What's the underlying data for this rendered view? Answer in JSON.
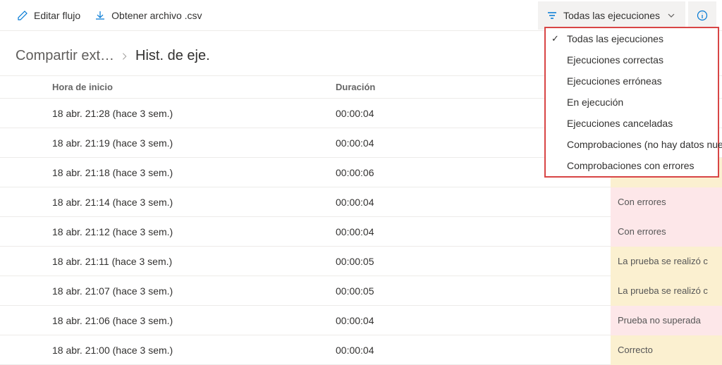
{
  "toolbar": {
    "edit_label": "Editar flujo",
    "download_label": "Obtener archivo .csv",
    "filter_label": "Todas las ejecuciones"
  },
  "breadcrumb": {
    "first": "Compartir ext…",
    "current": "Hist. de eje."
  },
  "table_headers": {
    "start": "Hora de inicio",
    "duration": "Duración"
  },
  "rows": [
    {
      "start": "18 abr. 21:28 (hace 3 sem.)",
      "duration": "00:00:04",
      "status": "",
      "cls": ""
    },
    {
      "start": "18 abr. 21:19 (hace 3 sem.)",
      "duration": "00:00:04",
      "status": "",
      "cls": ""
    },
    {
      "start": "18 abr. 21:18 (hace 3 sem.)",
      "duration": "00:00:06",
      "status": "La prueba se realizó c",
      "cls": "status-warn"
    },
    {
      "start": "18 abr. 21:14 (hace 3 sem.)",
      "duration": "00:00:04",
      "status": "Con errores",
      "cls": "status-error"
    },
    {
      "start": "18 abr. 21:12 (hace 3 sem.)",
      "duration": "00:00:04",
      "status": "Con errores",
      "cls": "status-error"
    },
    {
      "start": "18 abr. 21:11 (hace 3 sem.)",
      "duration": "00:00:05",
      "status": "La prueba se realizó c",
      "cls": "status-warn"
    },
    {
      "start": "18 abr. 21:07 (hace 3 sem.)",
      "duration": "00:00:05",
      "status": "La prueba se realizó c",
      "cls": "status-warn"
    },
    {
      "start": "18 abr. 21:06 (hace 3 sem.)",
      "duration": "00:00:04",
      "status": "Prueba no superada",
      "cls": "status-error"
    },
    {
      "start": "18 abr. 21:00 (hace 3 sem.)",
      "duration": "00:00:04",
      "status": "Correcto",
      "cls": "status-warn"
    }
  ],
  "dropdown": {
    "items": [
      {
        "label": "Todas las ejecuciones",
        "checked": true
      },
      {
        "label": "Ejecuciones correctas",
        "checked": false
      },
      {
        "label": "Ejecuciones erróneas",
        "checked": false
      },
      {
        "label": "En ejecución",
        "checked": false
      },
      {
        "label": "Ejecuciones canceladas",
        "checked": false
      },
      {
        "label": "Comprobaciones (no hay datos nuevos)",
        "checked": false
      },
      {
        "label": "Comprobaciones con errores",
        "checked": false
      }
    ]
  }
}
